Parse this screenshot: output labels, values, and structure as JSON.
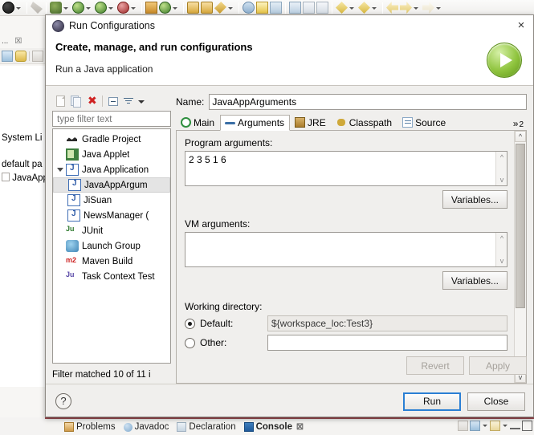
{
  "workbench": {
    "toolbar_icons": [
      "run-icon",
      "run-dropdown",
      "debug-icon",
      "bug-dropdown",
      "coverage-icon",
      "coverage-dropdown",
      "new-java-icon",
      "new-dropdown",
      "external-tools-icon",
      "external-dropdown",
      "search-icon",
      "refresh-icon",
      "open-type-icon",
      "open-task-icon",
      "next-annotation-icon",
      "prev-annotation-icon",
      "back-icon",
      "forward-icon"
    ],
    "left_panel": {
      "tab_labels": [
        "...",
        "☒"
      ],
      "tool_icons": [
        "collapse-all-icon",
        "link-with-editor-icon",
        "view-menu-icon"
      ],
      "tree_items": [
        "System Li",
        "default pa",
        "JavaApp"
      ]
    },
    "bottom_views": [
      {
        "label": "Problems",
        "icon": "problems-icon",
        "active": false
      },
      {
        "label": "Javadoc",
        "icon": "javadoc-icon",
        "active": false
      },
      {
        "label": "Declaration",
        "icon": "declaration-icon",
        "active": false
      },
      {
        "label": "Console",
        "icon": "console-icon",
        "active": true
      }
    ],
    "bottom_close_glyph": "☒"
  },
  "dialog": {
    "title": "Run Configurations",
    "title_icon": "run-configurations-icon",
    "close_glyph": "×",
    "header_title": "Create, manage, and run configurations",
    "header_subtitle": "Run a Java application",
    "header_icon": "green-run-play-icon",
    "tree_toolbar": [
      {
        "name": "new-launch-configuration-button",
        "icon": "new-config-icon",
        "enabled": false
      },
      {
        "name": "duplicate-launch-configuration-button",
        "icon": "duplicate-icon",
        "enabled": false
      },
      {
        "name": "delete-launch-configuration-button",
        "icon": "delete-red-x-icon",
        "enabled": true
      },
      {
        "name": "collapse-all-button",
        "icon": "collapse-all-icon",
        "enabled": true
      },
      {
        "name": "filter-button",
        "icon": "filter-icon",
        "enabled": true
      },
      {
        "name": "view-menu-button",
        "icon": "chevron-down-icon",
        "enabled": true
      }
    ],
    "filter": {
      "value": "",
      "placeholder": "type filter text"
    },
    "tree": [
      {
        "label": "Gradle Project",
        "icon": "gradle-icon",
        "depth": 0,
        "twisty": "none",
        "selected": false
      },
      {
        "label": "Java Applet",
        "icon": "java-applet-icon",
        "depth": 0,
        "twisty": "none",
        "selected": false
      },
      {
        "label": "Java Application",
        "icon": "java-application-icon",
        "depth": 0,
        "twisty": "open",
        "selected": false
      },
      {
        "label": "JavaAppArgum",
        "icon": "java-application-icon",
        "depth": 1,
        "twisty": "none",
        "selected": true
      },
      {
        "label": "JiSuan",
        "icon": "java-application-icon",
        "depth": 1,
        "twisty": "none",
        "selected": false
      },
      {
        "label": "NewsManager (",
        "icon": "java-application-icon",
        "depth": 1,
        "twisty": "none",
        "selected": false
      },
      {
        "label": "JUnit",
        "icon": "junit-icon",
        "depth": 0,
        "twisty": "none",
        "selected": false
      },
      {
        "label": "Launch Group",
        "icon": "launch-group-icon",
        "depth": 0,
        "twisty": "none",
        "selected": false
      },
      {
        "label": "Maven Build",
        "icon": "maven-icon",
        "depth": 0,
        "twisty": "none",
        "selected": false
      },
      {
        "label": "Task Context Test",
        "icon": "task-context-icon",
        "depth": 0,
        "twisty": "none",
        "selected": false
      }
    ],
    "tree_status": "Filter matched 10 of 11 i",
    "name_label": "Name:",
    "name_value": "JavaAppArguments",
    "tabs": [
      {
        "label": "Main",
        "icon": "main-tab-icon",
        "active": false
      },
      {
        "label": "Arguments",
        "icon": "arguments-tab-icon",
        "active": true
      },
      {
        "label": "JRE",
        "icon": "jre-tab-icon",
        "active": false
      },
      {
        "label": "Classpath",
        "icon": "classpath-tab-icon",
        "active": false
      },
      {
        "label": "Source",
        "icon": "source-tab-icon",
        "active": false
      }
    ],
    "tab_overflow": {
      "chevron": "»",
      "count": "2"
    },
    "program_arguments": {
      "label": "Program arguments:",
      "value": "2 3 5 1 6",
      "variables_button": "Variables..."
    },
    "vm_arguments": {
      "label": "VM arguments:",
      "value": "",
      "variables_button": "Variables..."
    },
    "working_directory": {
      "label": "Working directory:",
      "default_radio_label": "Default:",
      "default_radio_checked": true,
      "default_value": "${workspace_loc:Test3}",
      "other_radio_label": "Other:",
      "other_radio_checked": false,
      "other_value": ""
    },
    "revert_button": {
      "label": "Revert",
      "enabled": false
    },
    "apply_button": {
      "label": "Apply",
      "enabled": false
    },
    "help_button": {
      "glyph": "?"
    },
    "run_button": {
      "label": "Run",
      "default": true
    },
    "close_button": {
      "label": "Close",
      "default": false
    },
    "colors": {
      "accent_blue": "#2a7fd4",
      "run_green": "#8fc43e",
      "delete_red": "#cf2222",
      "selection_gray": "#e4e4e4"
    }
  }
}
